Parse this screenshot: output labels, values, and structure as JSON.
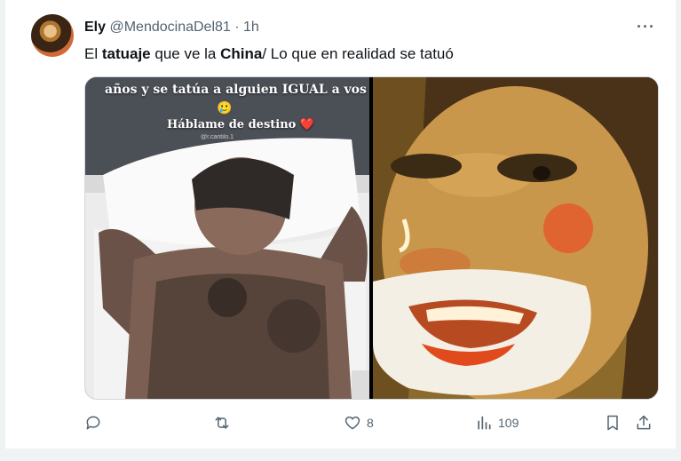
{
  "tweet": {
    "display_name": "Ely",
    "handle": "@MendocinaDel81",
    "separator": "·",
    "time": "1h",
    "more_label": "···",
    "text_parts": [
      "El ",
      "tatuaje",
      " que ve la ",
      "China",
      "/ Lo que en realidad se tatuó"
    ]
  },
  "media": {
    "left_image": {
      "caption_line1": "años y se tatúa a alguien IGUAL a vos",
      "caption_emoji": "🥲",
      "caption_line2": "Háblame de destino",
      "caption_heart": "❤️",
      "watermark": "@r.cantilo.1"
    }
  },
  "actions": {
    "reply_count": "",
    "retweet_count": "",
    "like_count": "8",
    "view_count": "109"
  },
  "icons": [
    "reply-icon",
    "retweet-icon",
    "like-icon",
    "views-icon",
    "bookmark-icon",
    "share-icon",
    "more-icon"
  ]
}
